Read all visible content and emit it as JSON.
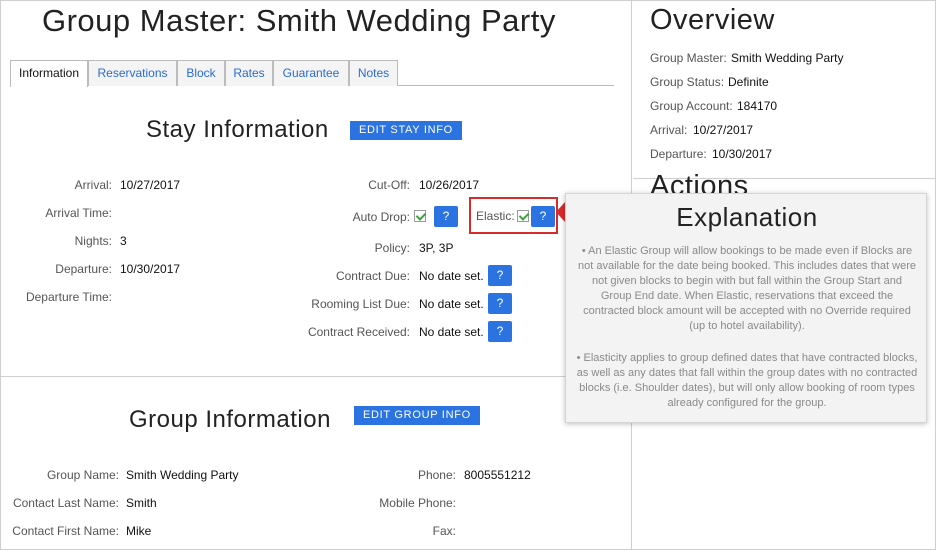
{
  "page": {
    "title": "Group Master: Smith Wedding Party"
  },
  "tabs": [
    "Information",
    "Reservations",
    "Block",
    "Rates",
    "Guarantee",
    "Notes"
  ],
  "stay": {
    "title": "Stay Information",
    "edit_label": "EDIT STAY INFO",
    "left": [
      {
        "label": "Arrival:",
        "value": "10/27/2017"
      },
      {
        "label": "Arrival Time:",
        "value": ""
      },
      {
        "label": "Nights:",
        "value": "3"
      },
      {
        "label": "Departure:",
        "value": "10/30/2017"
      },
      {
        "label": "Departure Time:",
        "value": ""
      }
    ],
    "cutoff": {
      "label": "Cut-Off:",
      "value": "10/26/2017"
    },
    "auto_drop": {
      "label": "Auto Drop:",
      "checked": true
    },
    "elastic": {
      "label": "Elastic:",
      "checked": true
    },
    "policy": {
      "label": "Policy:",
      "value": "3P, 3P"
    },
    "contract_due": {
      "label": "Contract Due:",
      "value": "No date set."
    },
    "rooming_due": {
      "label": "Rooming List Due:",
      "value": "No date set."
    },
    "contract_received": {
      "label": "Contract Received:",
      "value": "No date set."
    },
    "help_glyph": "?"
  },
  "group": {
    "title": "Group Information",
    "edit_label": "EDIT GROUP INFO",
    "group_name": {
      "label": "Group Name:",
      "value": "Smith Wedding Party"
    },
    "last_name": {
      "label": "Contact Last Name:",
      "value": "Smith"
    },
    "first_name": {
      "label": "Contact First Name:",
      "value": "Mike"
    },
    "phone": {
      "label": "Phone:",
      "value": "8005551212"
    },
    "mobile": {
      "label": "Mobile Phone:",
      "value": ""
    },
    "fax": {
      "label": "Fax:",
      "value": ""
    }
  },
  "overview": {
    "title": "Overview",
    "items": [
      {
        "label": "Group Master:",
        "value": "Smith Wedding Party"
      },
      {
        "label": "Group Status:",
        "value": "Definite"
      },
      {
        "label": "Group Account:",
        "value": "184170"
      },
      {
        "label": "Arrival:",
        "value": "10/27/2017"
      },
      {
        "label": "Departure:",
        "value": "10/30/2017"
      }
    ],
    "actions_title": "Actions"
  },
  "popup": {
    "title": "Explanation",
    "p1": "• An Elastic Group will allow bookings to be made even if Blocks are not available for the date being booked. This includes dates that were not given blocks to begin with but fall within the Group Start and Group End date. When Elastic, reservations that exceed the contracted block amount will be accepted with no Override required (up to hotel availability).",
    "p2": "• Elasticity applies to group defined dates that have contracted blocks, as well as any dates that fall within the group dates with no contracted blocks (i.e. Shoulder dates), but will only allow booking of room types already configured for the group."
  },
  "colors": {
    "accent": "#2b73e0",
    "highlight": "#d92b2b"
  }
}
